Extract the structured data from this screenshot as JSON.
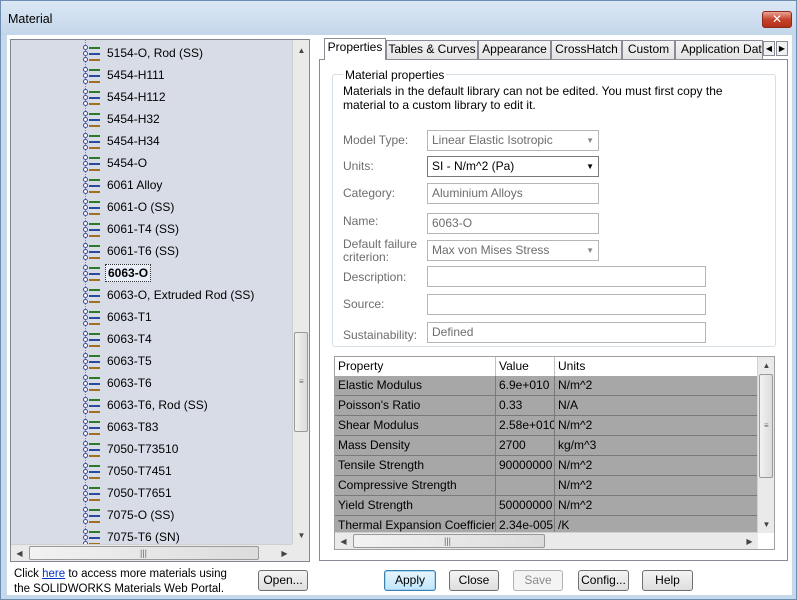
{
  "window": {
    "title": "Material",
    "close_label": "✕"
  },
  "tree": {
    "items": [
      {
        "label": "5154-O, Rod (SS)"
      },
      {
        "label": "5454-H111"
      },
      {
        "label": "5454-H112"
      },
      {
        "label": "5454-H32"
      },
      {
        "label": "5454-H34"
      },
      {
        "label": "5454-O"
      },
      {
        "label": "6061 Alloy"
      },
      {
        "label": "6061-O (SS)"
      },
      {
        "label": "6061-T4 (SS)"
      },
      {
        "label": "6061-T6 (SS)"
      },
      {
        "label": "6063-O",
        "selected": true
      },
      {
        "label": "6063-O, Extruded Rod (SS)"
      },
      {
        "label": "6063-T1"
      },
      {
        "label": "6063-T4"
      },
      {
        "label": "6063-T5"
      },
      {
        "label": "6063-T6"
      },
      {
        "label": "6063-T6, Rod (SS)"
      },
      {
        "label": "6063-T83"
      },
      {
        "label": "7050-T73510"
      },
      {
        "label": "7050-T7451"
      },
      {
        "label": "7050-T7651"
      },
      {
        "label": "7075-O (SS)"
      },
      {
        "label": "7075-T6 (SN)"
      }
    ]
  },
  "portal": {
    "before": "Click ",
    "link": "here",
    "after": " to access more materials using",
    "line2": "the SOLIDWORKS Materials Web Portal."
  },
  "buttons": {
    "open": "Open...",
    "apply": "Apply",
    "close": "Close",
    "save": "Save",
    "config": "Config...",
    "help": "Help"
  },
  "tabs": [
    "Properties",
    "Tables & Curves",
    "Appearance",
    "CrossHatch",
    "Custom",
    "Application Data"
  ],
  "properties": {
    "group_title": "Material properties",
    "description": "Materials in the default library can not be edited. You must first copy the material to a custom library to edit it.",
    "model_type_label": "Model Type:",
    "model_type_value": "Linear Elastic Isotropic",
    "units_label": "Units:",
    "units_value": "SI - N/m^2 (Pa)",
    "category_label": "Category:",
    "category_value": "Aluminium Alloys",
    "name_label": "Name:",
    "name_value": "6063-O",
    "failure_label_1": "Default failure",
    "failure_label_2": "criterion:",
    "failure_value": "Max von Mises Stress",
    "description_label": "Description:",
    "description_value": "",
    "source_label": "Source:",
    "source_value": "",
    "sustainability_label": "Sustainability:",
    "sustainability_value": "Defined"
  },
  "table": {
    "headers": [
      "Property",
      "Value",
      "Units"
    ],
    "rows": [
      [
        "Elastic Modulus",
        "6.9e+010",
        "N/m^2"
      ],
      [
        "Poisson's Ratio",
        "0.33",
        "N/A"
      ],
      [
        "Shear Modulus",
        "2.58e+010",
        "N/m^2"
      ],
      [
        "Mass Density",
        "2700",
        "kg/m^3"
      ],
      [
        "Tensile Strength",
        "90000000",
        "N/m^2"
      ],
      [
        "Compressive Strength",
        "",
        "N/m^2"
      ],
      [
        "Yield Strength",
        "50000000",
        "N/m^2"
      ],
      [
        "Thermal Expansion Coefficient",
        "2.34e-005",
        "/K"
      ]
    ]
  }
}
